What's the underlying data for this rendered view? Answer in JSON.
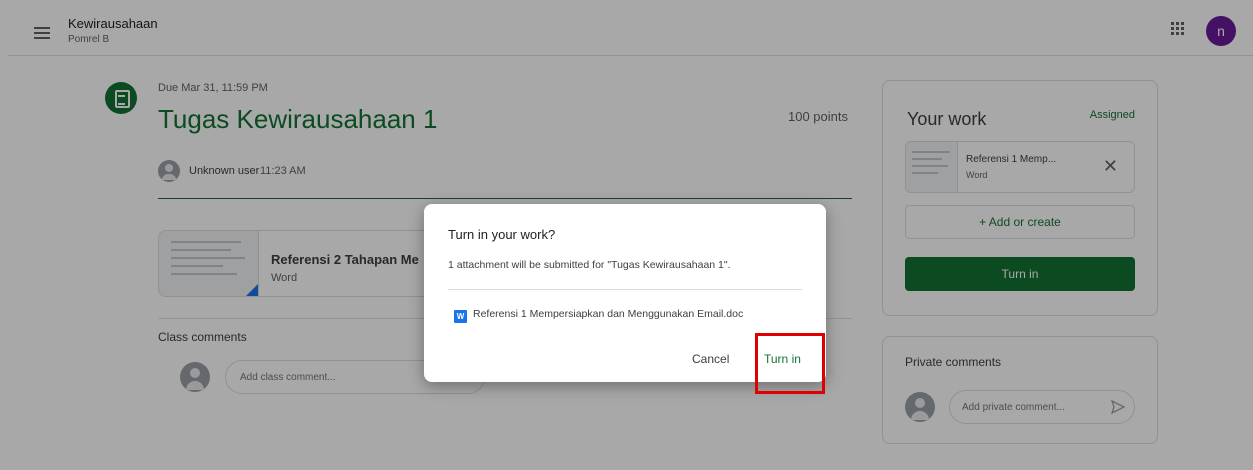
{
  "header": {
    "course_title": "Kewirausahaan",
    "course_subtitle": "Pomrel B",
    "avatar_letter": "n"
  },
  "assignment": {
    "due": "Due Mar 31, 11:59 PM",
    "title": "Tugas Kewirausahaan 1",
    "points": "100 points",
    "author": "Unknown user",
    "time": "11:23 AM",
    "attachment": {
      "name": "Referensi 2 Tahapan Me",
      "type": "Word"
    }
  },
  "class_comments": {
    "heading": "Class comments",
    "placeholder": "Add class comment..."
  },
  "your_work": {
    "title": "Your work",
    "status": "Assigned",
    "file": {
      "name": "Referensi 1 Memp...",
      "type": "Word"
    },
    "add_create_label": "+ Add or create",
    "turn_in_label": "Turn in"
  },
  "private_comments": {
    "heading": "Private comments",
    "placeholder": "Add private comment..."
  },
  "dialog": {
    "title": "Turn in your work?",
    "body": "1 attachment will be submitted for \"Tugas Kewirausahaan 1\".",
    "file_badge": "W",
    "file_name": "Referensi 1 Mempersiapkan dan Menggunakan Email.doc",
    "cancel_label": "Cancel",
    "turn_in_label": "Turn in"
  },
  "colors": {
    "accent_green": "#137333",
    "highlight_red": "#e00000",
    "avatar_purple": "#6a1b9a"
  }
}
